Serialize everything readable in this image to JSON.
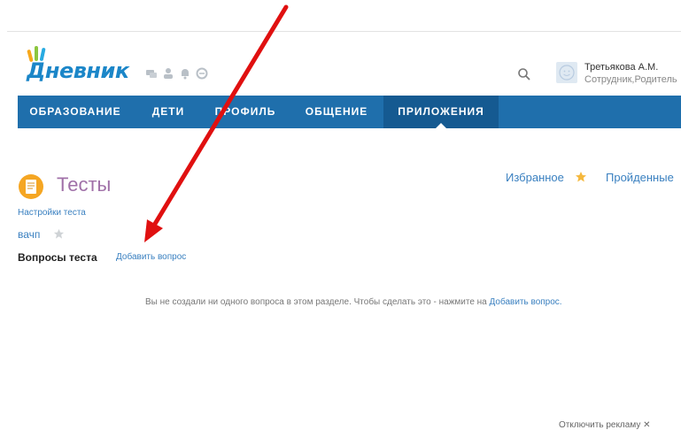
{
  "header": {
    "logo_text": "Дневник",
    "user": {
      "name": "Третьякова А.М.",
      "role": "Сотрудник,Родитель"
    }
  },
  "nav": {
    "items": [
      {
        "label": "ОБРАЗОВАНИЕ"
      },
      {
        "label": "ДЕТИ"
      },
      {
        "label": "ПРОФИЛЬ"
      },
      {
        "label": "ОБЩЕНИЕ"
      },
      {
        "label": "ПРИЛОЖЕНИЯ",
        "active": true
      }
    ]
  },
  "page": {
    "title": "Тесты",
    "favorites_label": "Избранное",
    "completed_label": "Пройденные",
    "settings_link": "Настройки теста",
    "test_name": "вачп",
    "questions_label": "Вопросы теста",
    "add_question_link": "Добавить вопрос",
    "empty_message": "Вы не создали ни одного вопроса в этом разделе. Чтобы сделать это - нажмите на",
    "empty_message_link": "Добавить вопрос."
  },
  "footer": {
    "ad_off": "Отключить рекламу ✕"
  },
  "colors": {
    "nav": "#1f6fac",
    "nav_active": "#155a91",
    "link": "#3a80c0",
    "title": "#a070a8",
    "arrow": "#e01010"
  },
  "icons": [
    "chat-icon",
    "person-icon",
    "bell-icon",
    "globe-icon",
    "search-icon",
    "star-icon",
    "tests-icon"
  ]
}
